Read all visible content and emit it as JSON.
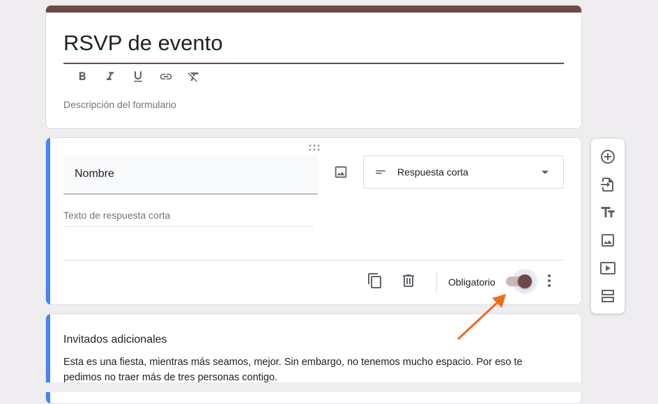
{
  "form": {
    "title": "RSVP de evento",
    "description_placeholder": "Descripción del formulario",
    "accent_color": "#6e4a47"
  },
  "format_toolbar": [
    "bold-icon",
    "italic-icon",
    "underline-icon",
    "link-icon",
    "clear-format-icon"
  ],
  "question": {
    "title": "Nombre",
    "type_label": "Respuesta corta",
    "answer_hint": "Texto de respuesta corta",
    "required_label": "Obligatorio",
    "required": true
  },
  "side_toolbar": [
    "add-question-icon",
    "import-questions-icon",
    "add-title-icon",
    "add-image-icon",
    "add-video-icon",
    "add-section-icon"
  ],
  "section": {
    "title": "Invitados adicionales",
    "description": "Esta es una fiesta, mientras más seamos, mejor. Sin embargo, no tenemos mucho espacio. Por eso te pedimos no traer más de tres personas contigo."
  },
  "annotation_color": "#f26b1d"
}
